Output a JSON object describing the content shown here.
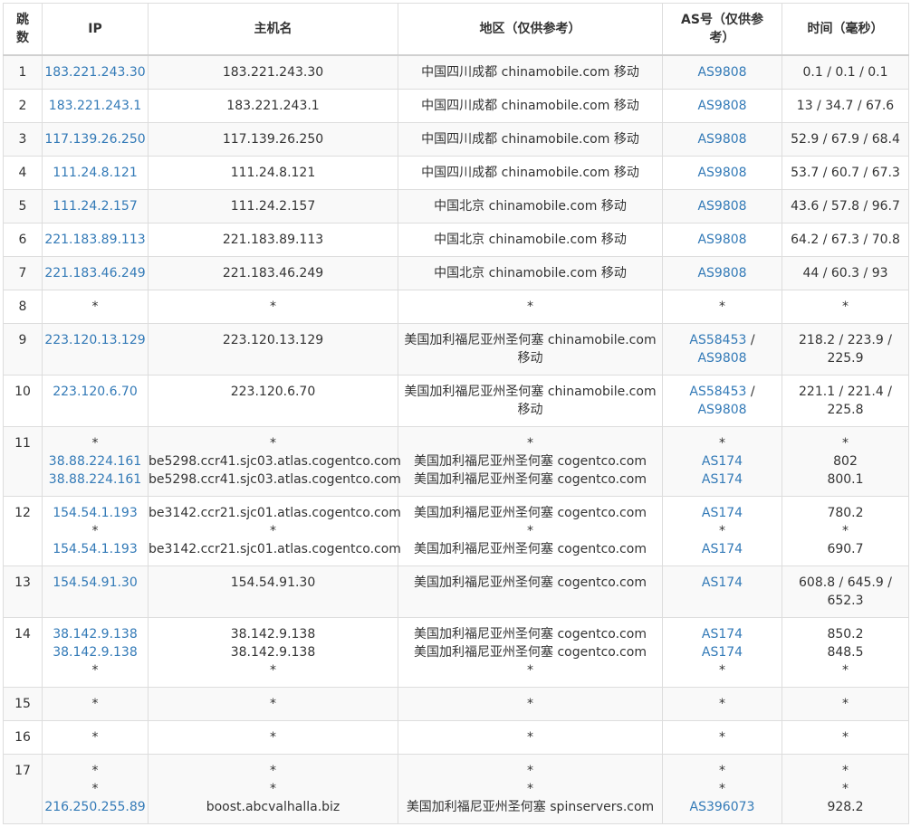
{
  "headers": {
    "hop": "跳数",
    "ip": "IP",
    "host": "主机名",
    "region": "地区（仅供参考）",
    "as": "AS号（仅供参考）",
    "time": "时间（毫秒）"
  },
  "rows": [
    {
      "hop": "1",
      "ip": [
        "183.221.243.30"
      ],
      "host": [
        "183.221.243.30"
      ],
      "region": [
        "中国四川成都 chinamobile.com 移动"
      ],
      "as": [
        "AS9808"
      ],
      "time": [
        "0.1 / 0.1 / 0.1"
      ]
    },
    {
      "hop": "2",
      "ip": [
        "183.221.243.1"
      ],
      "host": [
        "183.221.243.1"
      ],
      "region": [
        "中国四川成都 chinamobile.com 移动"
      ],
      "as": [
        "AS9808"
      ],
      "time": [
        "13 / 34.7 / 67.6"
      ]
    },
    {
      "hop": "3",
      "ip": [
        "117.139.26.250"
      ],
      "host": [
        "117.139.26.250"
      ],
      "region": [
        "中国四川成都 chinamobile.com 移动"
      ],
      "as": [
        "AS9808"
      ],
      "time": [
        "52.9 / 67.9 / 68.4"
      ]
    },
    {
      "hop": "4",
      "ip": [
        "111.24.8.121"
      ],
      "host": [
        "111.24.8.121"
      ],
      "region": [
        "中国四川成都 chinamobile.com 移动"
      ],
      "as": [
        "AS9808"
      ],
      "time": [
        "53.7 / 60.7 / 67.3"
      ]
    },
    {
      "hop": "5",
      "ip": [
        "111.24.2.157"
      ],
      "host": [
        "111.24.2.157"
      ],
      "region": [
        "中国北京 chinamobile.com 移动"
      ],
      "as": [
        "AS9808"
      ],
      "time": [
        "43.6 / 57.8 / 96.7"
      ]
    },
    {
      "hop": "6",
      "ip": [
        "221.183.89.113"
      ],
      "host": [
        "221.183.89.113"
      ],
      "region": [
        "中国北京 chinamobile.com 移动"
      ],
      "as": [
        "AS9808"
      ],
      "time": [
        "64.2 / 67.3 / 70.8"
      ]
    },
    {
      "hop": "7",
      "ip": [
        "221.183.46.249"
      ],
      "host": [
        "221.183.46.249"
      ],
      "region": [
        "中国北京 chinamobile.com 移动"
      ],
      "as": [
        "AS9808"
      ],
      "time": [
        "44 / 60.3 / 93"
      ]
    },
    {
      "hop": "8",
      "ip": [
        "*"
      ],
      "host": [
        "*"
      ],
      "region": [
        "*"
      ],
      "as": [
        "*"
      ],
      "time": [
        "*"
      ]
    },
    {
      "hop": "9",
      "ip": [
        "223.120.13.129"
      ],
      "host": [
        "223.120.13.129"
      ],
      "region": [
        "美国加利福尼亚州圣何塞 chinamobile.com",
        "移动"
      ],
      "as": [
        "AS58453 /",
        "AS9808"
      ],
      "time": [
        "218.2 / 223.9 /",
        "225.9"
      ]
    },
    {
      "hop": "10",
      "ip": [
        "223.120.6.70"
      ],
      "host": [
        "223.120.6.70"
      ],
      "region": [
        "美国加利福尼亚州圣何塞 chinamobile.com",
        "移动"
      ],
      "as": [
        "AS58453 /",
        "AS9808"
      ],
      "time": [
        "221.1 / 221.4 /",
        "225.8"
      ]
    },
    {
      "hop": "11",
      "ip": [
        "*",
        "38.88.224.161",
        "38.88.224.161"
      ],
      "host": [
        "*",
        "be5298.ccr41.sjc03.atlas.cogentco.com",
        "be5298.ccr41.sjc03.atlas.cogentco.com"
      ],
      "region": [
        "*",
        "美国加利福尼亚州圣何塞 cogentco.com",
        "美国加利福尼亚州圣何塞 cogentco.com"
      ],
      "as": [
        "*",
        "AS174",
        "AS174"
      ],
      "time": [
        "*",
        "802",
        "800.1"
      ]
    },
    {
      "hop": "12",
      "ip": [
        "154.54.1.193",
        "*",
        "154.54.1.193"
      ],
      "host": [
        "be3142.ccr21.sjc01.atlas.cogentco.com",
        "*",
        "be3142.ccr21.sjc01.atlas.cogentco.com"
      ],
      "region": [
        "美国加利福尼亚州圣何塞 cogentco.com",
        "*",
        "美国加利福尼亚州圣何塞 cogentco.com"
      ],
      "as": [
        "AS174",
        "*",
        "AS174"
      ],
      "time": [
        "780.2",
        "*",
        "690.7"
      ]
    },
    {
      "hop": "13",
      "ip": [
        "154.54.91.30"
      ],
      "host": [
        "154.54.91.30"
      ],
      "region": [
        "美国加利福尼亚州圣何塞 cogentco.com"
      ],
      "as": [
        "AS174"
      ],
      "time": [
        "608.8 / 645.9 /",
        "652.3"
      ]
    },
    {
      "hop": "14",
      "ip": [
        "38.142.9.138",
        "38.142.9.138",
        "*"
      ],
      "host": [
        "38.142.9.138",
        "38.142.9.138",
        "*"
      ],
      "region": [
        "美国加利福尼亚州圣何塞 cogentco.com",
        "美国加利福尼亚州圣何塞 cogentco.com",
        "*"
      ],
      "as": [
        "AS174",
        "AS174",
        "*"
      ],
      "time": [
        "850.2",
        "848.5",
        "*"
      ]
    },
    {
      "hop": "15",
      "ip": [
        "*"
      ],
      "host": [
        "*"
      ],
      "region": [
        "*"
      ],
      "as": [
        "*"
      ],
      "time": [
        "*"
      ]
    },
    {
      "hop": "16",
      "ip": [
        "*"
      ],
      "host": [
        "*"
      ],
      "region": [
        "*"
      ],
      "as": [
        "*"
      ],
      "time": [
        "*"
      ]
    },
    {
      "hop": "17",
      "ip": [
        "*",
        "*",
        "216.250.255.89"
      ],
      "host": [
        "*",
        "*",
        "boost.abcvalhalla.biz"
      ],
      "region": [
        "*",
        "*",
        "美国加利福尼亚州圣何塞 spinservers.com"
      ],
      "as": [
        "*",
        "*",
        "AS396073"
      ],
      "time": [
        "*",
        "*",
        "928.2"
      ]
    }
  ],
  "colors": {
    "link": "#337ab7",
    "text": "#333333",
    "border": "#dddddd",
    "stripe": "#f9f9f9"
  }
}
